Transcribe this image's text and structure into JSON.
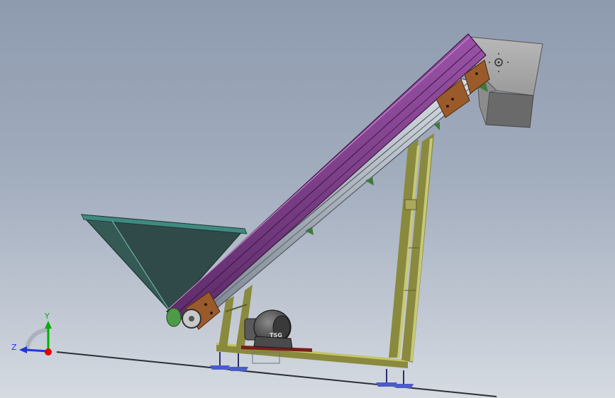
{
  "viewport": {
    "background_top": "#8e9aae",
    "background_bottom": "#d6dbe2"
  },
  "model": {
    "colors": {
      "belt": "#7a3a86",
      "hopper": "#2f4a48",
      "hopper_rim": "#3f8a80",
      "frame": "#8a8a3e",
      "bracket": "#9a5a2a",
      "discharge": "#a7a7a7",
      "motor": "#4a4a4a",
      "foot": "#4a5cc8"
    },
    "motor_label": "TSG"
  },
  "triad": {
    "x_label": "",
    "y_label": "Y",
    "z_label": "Z",
    "colors": {
      "x": "#e00000",
      "y": "#00b000",
      "z": "#1f36d8"
    }
  }
}
